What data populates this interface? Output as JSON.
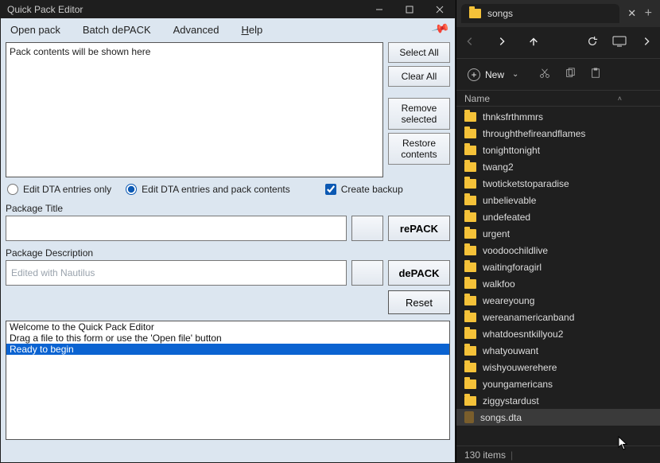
{
  "app": {
    "title": "Quick Pack Editor",
    "menu": {
      "open_pack": "Open pack",
      "batch_depack": "Batch dePACK",
      "advanced": "Advanced",
      "help": "Help"
    },
    "contents_placeholder": "Pack contents will be shown here",
    "buttons": {
      "select_all": "Select All",
      "clear_all": "Clear All",
      "remove_selected": "Remove\nselected",
      "restore_contents": "Restore\ncontents",
      "repack": "rePACK",
      "depack": "dePACK",
      "reset": "Reset"
    },
    "options": {
      "edit_dta_only": "Edit DTA entries only",
      "edit_dta_and_pack": "Edit DTA entries and pack contents",
      "create_backup": "Create backup"
    },
    "labels": {
      "package_title": "Package Title",
      "package_description": "Package Description"
    },
    "fields": {
      "package_title": "",
      "package_description": "Edited with Nautilus"
    },
    "log": {
      "l1": "Welcome to the Quick Pack Editor",
      "l2": "Drag a file to this form or use the 'Open file' button",
      "l3": "Ready to begin"
    }
  },
  "explorer": {
    "tab_title": "songs",
    "toolbar": {
      "new_label": "New"
    },
    "header": {
      "name_col": "Name"
    },
    "items": [
      {
        "name": "thnksfrthmmrs",
        "type": "folder"
      },
      {
        "name": "throughthefireandflames",
        "type": "folder"
      },
      {
        "name": "tonighttonight",
        "type": "folder"
      },
      {
        "name": "twang2",
        "type": "folder"
      },
      {
        "name": "twoticketstoparadise",
        "type": "folder"
      },
      {
        "name": "unbelievable",
        "type": "folder"
      },
      {
        "name": "undefeated",
        "type": "folder"
      },
      {
        "name": "urgent",
        "type": "folder"
      },
      {
        "name": "voodoochildlive",
        "type": "folder"
      },
      {
        "name": "waitingforagirl",
        "type": "folder"
      },
      {
        "name": "walkfoo",
        "type": "folder"
      },
      {
        "name": "weareyoung",
        "type": "folder"
      },
      {
        "name": "wereanamericanband",
        "type": "folder"
      },
      {
        "name": "whatdoesntkillyou2",
        "type": "folder"
      },
      {
        "name": "whatyouwant",
        "type": "folder"
      },
      {
        "name": "wishyouwerehere",
        "type": "folder"
      },
      {
        "name": "youngamericans",
        "type": "folder"
      },
      {
        "name": "ziggystardust",
        "type": "folder"
      },
      {
        "name": "songs.dta",
        "type": "file",
        "selected": true
      }
    ],
    "status": {
      "count": "130 items"
    }
  }
}
